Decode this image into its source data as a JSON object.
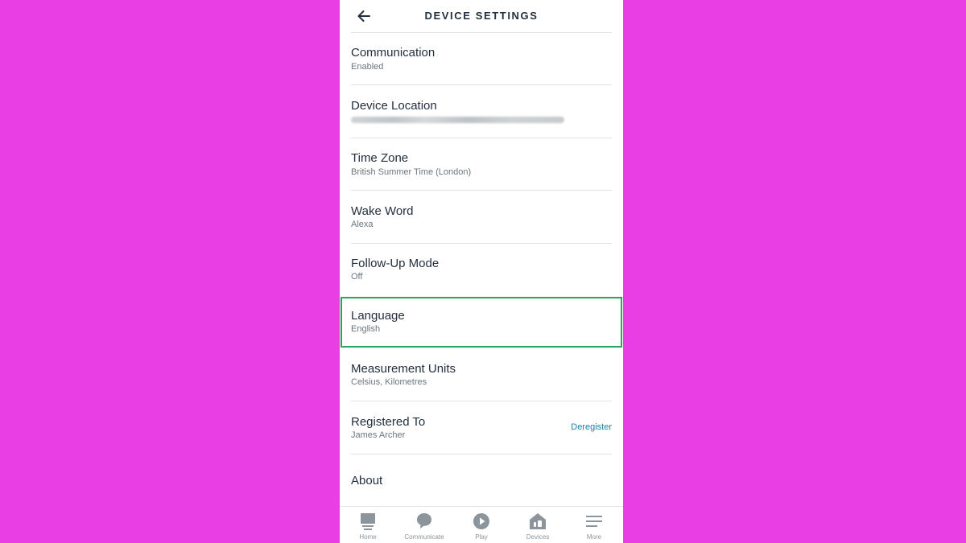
{
  "header": {
    "title": "DEVICE SETTINGS",
    "back_icon": "arrow-left-icon"
  },
  "settings": [
    {
      "label": "Communication",
      "value": "Enabled"
    },
    {
      "label": "Device Location",
      "value": ""
    },
    {
      "label": "Time Zone",
      "value": "British Summer Time (London)"
    },
    {
      "label": "Wake Word",
      "value": "Alexa"
    },
    {
      "label": "Follow-Up Mode",
      "value": "Off"
    },
    {
      "label": "Language",
      "value": "English",
      "highlighted": true
    },
    {
      "label": "Measurement Units",
      "value": "Celsius, Kilometres"
    },
    {
      "label": "Registered To",
      "value": "James Archer",
      "action": "Deregister"
    },
    {
      "label": "About"
    }
  ],
  "tabs": [
    {
      "label": "Home",
      "icon": "home-icon"
    },
    {
      "label": "Communicate",
      "icon": "chat-bubble-icon"
    },
    {
      "label": "Play",
      "icon": "play-icon"
    },
    {
      "label": "Devices",
      "icon": "devices-icon"
    },
    {
      "label": "More",
      "icon": "menu-icon"
    }
  ],
  "colors": {
    "background": "#ea3ee5",
    "highlight": "#26a65b",
    "link": "#1d7fa3",
    "tab_icon": "#8c959c"
  }
}
